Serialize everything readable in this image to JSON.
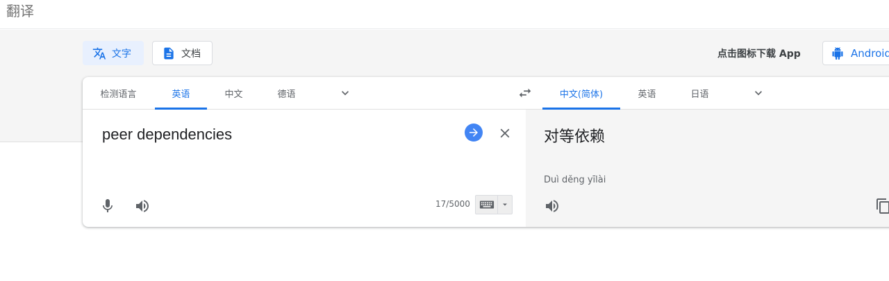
{
  "header": {
    "title": "翻译"
  },
  "modes": [
    {
      "label": "文字",
      "icon": "translate-icon",
      "active": true
    },
    {
      "label": "文档",
      "icon": "document-icon",
      "active": false
    }
  ],
  "app_promo": {
    "text": "点击图标下载 App",
    "android_label": "Android"
  },
  "source_langs": [
    {
      "label": "检测语言",
      "active": false
    },
    {
      "label": "英语",
      "active": true
    },
    {
      "label": "中文",
      "active": false
    },
    {
      "label": "德语",
      "active": false
    }
  ],
  "target_langs": [
    {
      "label": "中文(简体)",
      "active": true
    },
    {
      "label": "英语",
      "active": false
    },
    {
      "label": "日语",
      "active": false
    }
  ],
  "source": {
    "text": "peer dependencies",
    "char_count": "17/5000"
  },
  "target": {
    "text": "对等依赖",
    "pinyin": "Duì děng yīlài"
  },
  "colors": {
    "accent": "#1a73e8",
    "go_button": "#4285f4",
    "panel_gray": "#f5f5f5"
  }
}
